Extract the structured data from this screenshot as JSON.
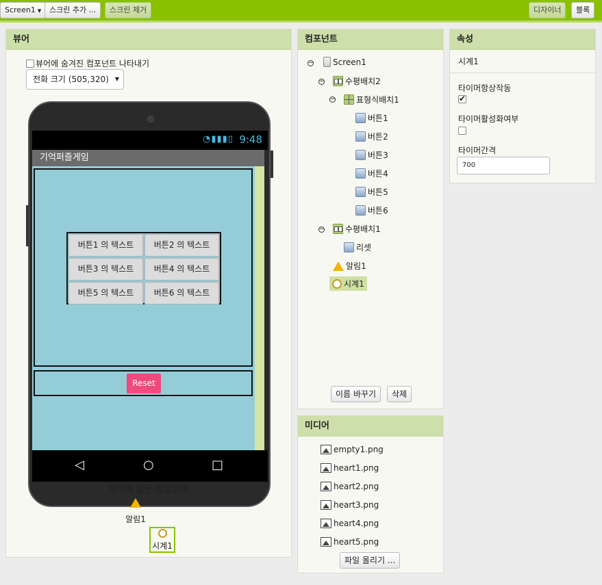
{
  "toolbar": {
    "screen_select": "Screen1",
    "add_screen": "스크린 추가 ...",
    "remove_screen": "스크린 제거",
    "designer": "디자이너",
    "blocks": "블록"
  },
  "viewer": {
    "title": "뷰어",
    "show_hidden": "뷰어에 숨겨진 컴포넌트 나타내기",
    "size_select": "전화 크기 (505,320)",
    "status_time": "9:48",
    "app_title": "기억퍼즐게임",
    "puzzle_buttons": [
      "버튼1 의 텍스트",
      "버튼2 의 텍스트",
      "버튼3 의 텍스트",
      "버튼4 의 텍스트",
      "버튼5 의 텍스트",
      "버튼6 의 텍스트"
    ],
    "reset_label": "Reset",
    "nonvisible_title": "보이지 않는 컴포넌트",
    "nonvisible": [
      "알림1",
      "시계1"
    ]
  },
  "components": {
    "title": "컴포넌트",
    "tree": {
      "screen": "Screen1",
      "hbox2": "수평배치2",
      "table": "표형식배치1",
      "buttons": [
        "버튼1",
        "버튼2",
        "버튼3",
        "버튼4",
        "버튼5",
        "버튼6"
      ],
      "hbox1": "수평배치1",
      "reset": "리셋",
      "notifier": "알림1",
      "clock": "시계1"
    },
    "rename": "이름 바꾸기",
    "delete": "삭제"
  },
  "media": {
    "title": "미디어",
    "files": [
      "empty1.png",
      "heart1.png",
      "heart2.png",
      "heart3.png",
      "heart4.png",
      "heart5.png"
    ],
    "upload": "파일 올리기 ..."
  },
  "properties": {
    "title": "속성",
    "component": "시계1",
    "always_fires_label": "타이머항상작동",
    "always_fires_checked": true,
    "enabled_label": "타이머활성화여부",
    "enabled_checked": false,
    "interval_label": "타이머간격",
    "interval_value": "700"
  }
}
